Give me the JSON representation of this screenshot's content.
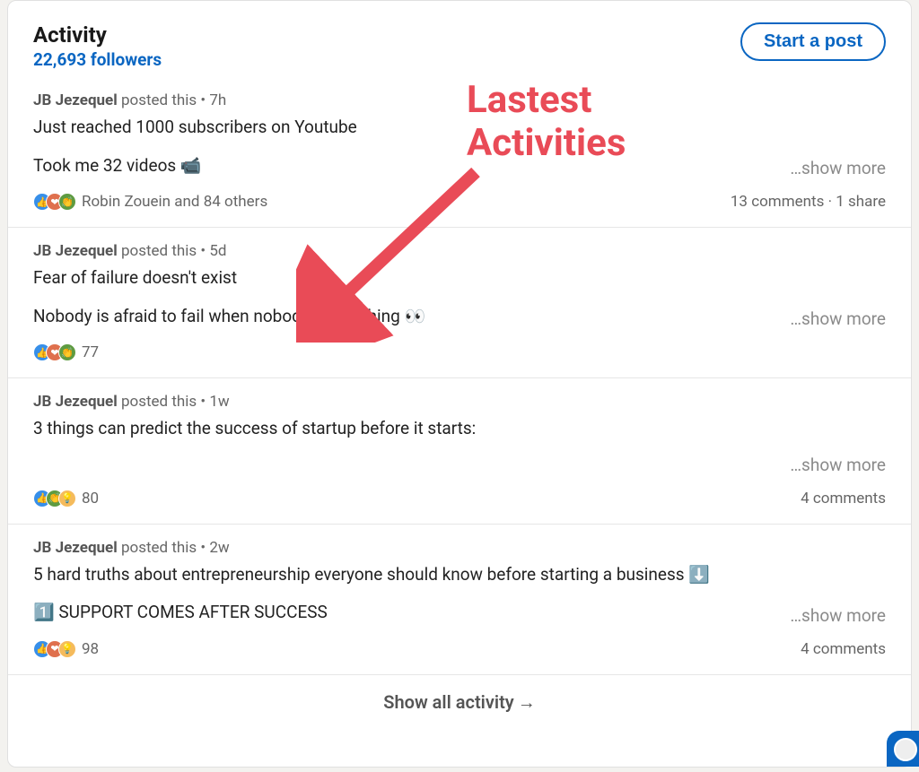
{
  "header": {
    "title": "Activity",
    "followers": "22,693 followers",
    "start_post": "Start a post"
  },
  "annotation": {
    "line1": "Lastest",
    "line2": "Activities"
  },
  "show_more_label": "…show more",
  "show_all_label": "Show all activity",
  "posts": [
    {
      "author": "JB Jezequel",
      "meta": " posted this • 7h",
      "line1": "Just reached 1000 subscribers on Youtube",
      "line2": "Took me 32 videos 📹",
      "react_types": [
        "like",
        "heart",
        "clap"
      ],
      "reactions_text": "Robin Zouein and 84 others",
      "right": "13 comments · 1 share"
    },
    {
      "author": "JB Jezequel",
      "meta": " posted this • 5d",
      "line1": "Fear of failure doesn't exist",
      "line2": "Nobody is afraid to fail when nobody is watching 👀",
      "react_types": [
        "like",
        "heart",
        "clap"
      ],
      "reactions_text": "77",
      "right": ""
    },
    {
      "author": "JB Jezequel",
      "meta": " posted this • 1w",
      "line1": "3 things can predict the success of startup before it starts:",
      "line2": "",
      "react_types": [
        "like",
        "clap",
        "bulb"
      ],
      "reactions_text": "80",
      "right": "4 comments"
    },
    {
      "author": "JB Jezequel",
      "meta": " posted this • 2w",
      "line1": "5 hard truths about entrepreneurship everyone should know before starting a business ⬇️",
      "line2": "1️⃣ SUPPORT COMES AFTER SUCCESS",
      "react_types": [
        "like",
        "heart",
        "bulb"
      ],
      "reactions_text": "98",
      "right": "4 comments"
    }
  ]
}
